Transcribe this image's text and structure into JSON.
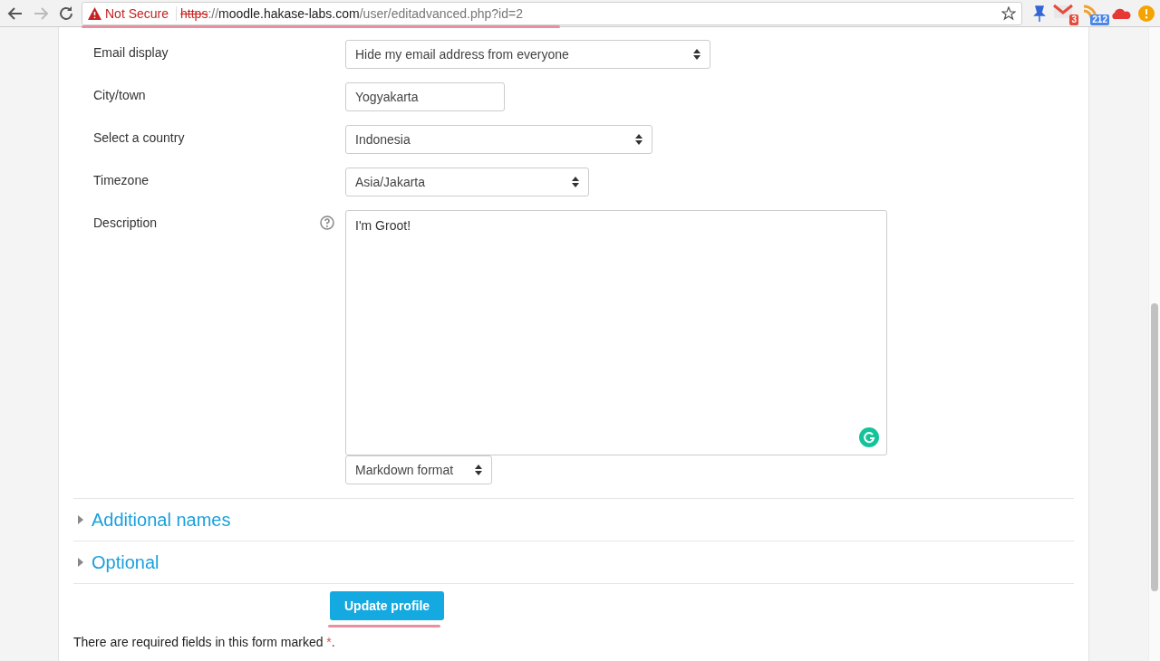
{
  "browser": {
    "security": "Not Secure",
    "url_scheme": "https",
    "url_separator": "://",
    "url_host": "moodle.hakase-labs.com",
    "url_path": "/user/editadvanced.php?id=2",
    "extension_badges": [
      "3",
      "212"
    ]
  },
  "form": {
    "fields": [
      {
        "kind": "select",
        "label": "Email display",
        "value": "Hide my email address from everyone"
      },
      {
        "kind": "text",
        "label": "City/town",
        "value": "Yogyakarta"
      },
      {
        "kind": "select",
        "label": "Select a country",
        "value": "Indonesia"
      },
      {
        "kind": "select",
        "label": "Timezone",
        "value": "Asia/Jakarta"
      },
      {
        "kind": "editor",
        "label": "Description",
        "value": "I'm Groot!",
        "help": true,
        "format": "Markdown format"
      }
    ],
    "sections": [
      {
        "title": "Additional names",
        "expanded": false
      },
      {
        "title": "Optional",
        "expanded": false
      }
    ],
    "submit": "Update profile",
    "note": {
      "text": "There are required fields in this form marked ",
      "marker": "*",
      "end": "."
    }
  }
}
